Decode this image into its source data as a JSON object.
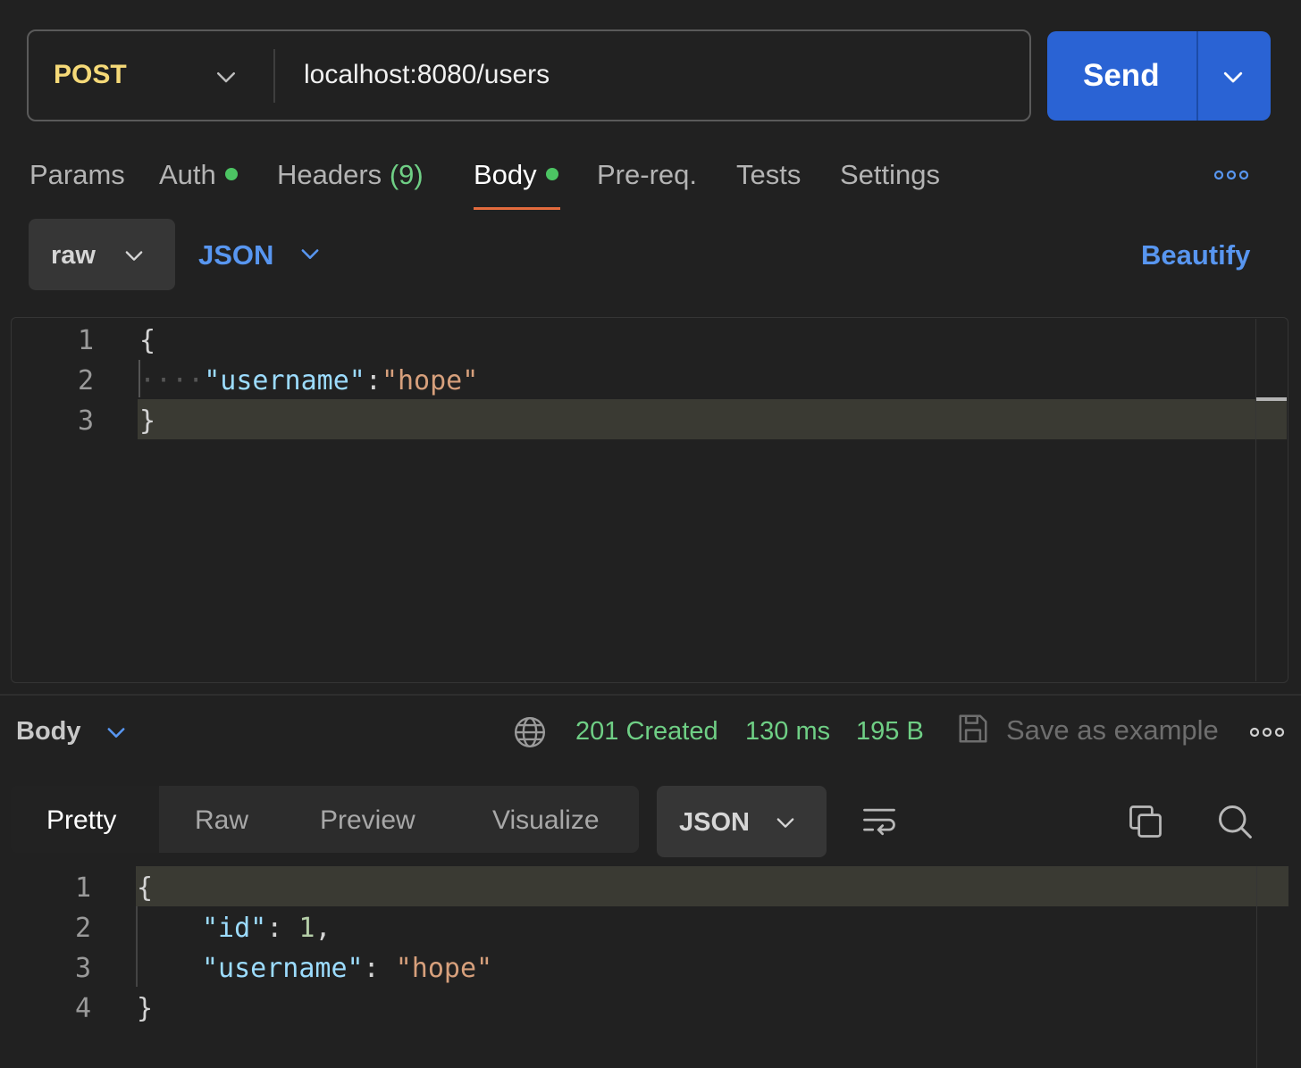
{
  "request": {
    "method": "POST",
    "url": "localhost:8080/users",
    "send_label": "Send"
  },
  "tabs": {
    "params": "Params",
    "auth": "Auth",
    "headers": "Headers",
    "headers_count": "(9)",
    "body": "Body",
    "prereq": "Pre-req.",
    "tests": "Tests",
    "settings": "Settings"
  },
  "body_options": {
    "mode": "raw",
    "language": "JSON",
    "beautify": "Beautify"
  },
  "request_editor": {
    "line_numbers": [
      "1",
      "2",
      "3"
    ],
    "line1": "{",
    "indent": "····",
    "key": "\"username\"",
    "colon": ":",
    "value": "\"hope\"",
    "line3": "}"
  },
  "response": {
    "section_label": "Body",
    "status": "201 Created",
    "time": "130 ms",
    "size": "195 B",
    "save_example": "Save as example",
    "modes": [
      "Pretty",
      "Raw",
      "Preview",
      "Visualize"
    ],
    "format": "JSON",
    "editor": {
      "line_numbers": [
        "1",
        "2",
        "3",
        "4"
      ],
      "line1": "{",
      "id_key": "\"id\"",
      "id_colon": ": ",
      "id_value": "1",
      "comma": ",",
      "username_key": "\"username\"",
      "username_colon": ": ",
      "username_value": "\"hope\"",
      "line4": "}"
    }
  },
  "colors": {
    "method": "#f5d978",
    "send_button": "#2a63d4",
    "accent_blue": "#5896f0",
    "status_green": "#6fcf85",
    "tab_underline": "#e36b3d",
    "dot_green": "#4cc463"
  },
  "icons": [
    "chevron-down-icon",
    "more-icon",
    "globe-icon",
    "save-icon",
    "wrap-lines-icon",
    "copy-icon",
    "search-icon"
  ]
}
